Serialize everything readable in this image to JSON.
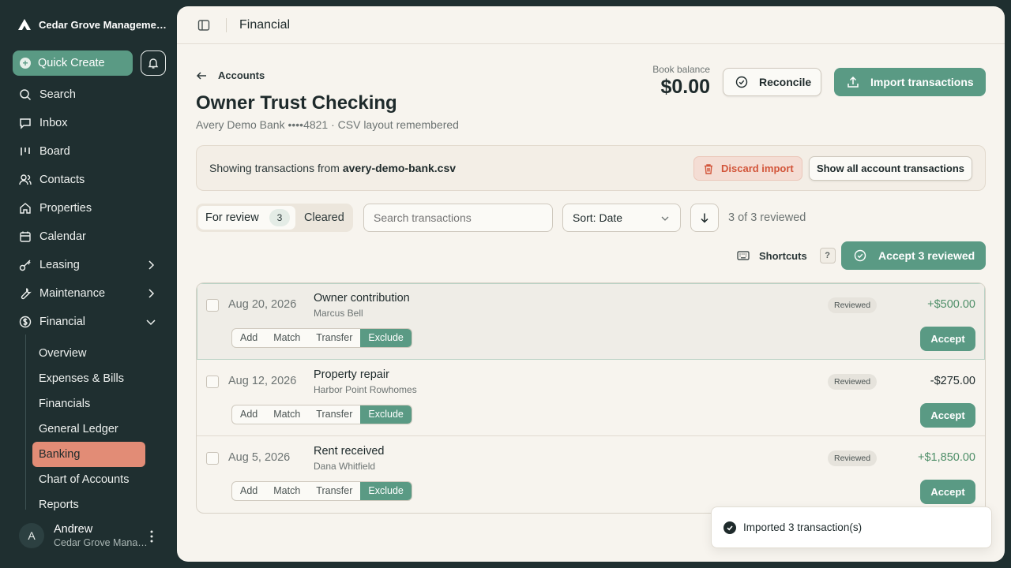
{
  "app": {
    "org_name": "Cedar Grove Manageme…"
  },
  "sidebar": {
    "quick_create": "Quick Create",
    "items": [
      {
        "label": "Search",
        "icon": "search-icon"
      },
      {
        "label": "Inbox",
        "icon": "inbox-icon"
      },
      {
        "label": "Board",
        "icon": "board-icon"
      },
      {
        "label": "Contacts",
        "icon": "contacts-icon"
      },
      {
        "label": "Properties",
        "icon": "home-icon"
      },
      {
        "label": "Calendar",
        "icon": "calendar-icon"
      },
      {
        "label": "Leasing",
        "icon": "key-icon"
      },
      {
        "label": "Maintenance",
        "icon": "wrench-icon"
      },
      {
        "label": "Financial",
        "icon": "dollar-icon"
      }
    ],
    "financial_sub": [
      "Overview",
      "Expenses & Bills",
      "Financials",
      "General Ledger",
      "Banking",
      "Chart of Accounts",
      "Reports"
    ],
    "active_sub": "Banking",
    "user": {
      "initial": "A",
      "name": "Andrew",
      "org": "Cedar Grove Mana…"
    }
  },
  "header": {
    "title": "Financial"
  },
  "account": {
    "back_label": "Accounts",
    "name": "Owner Trust Checking",
    "subtitle": "Avery Demo Bank ••••4821 · CSV layout remembered",
    "balance_label": "Book balance",
    "balance_value": "$0.00",
    "reconcile_label": "Reconcile",
    "import_label": "Import transactions"
  },
  "banner": {
    "prefix": "Showing transactions from ",
    "file": "avery-demo-bank.csv",
    "discard_label": "Discard import",
    "show_all_label": "Show all account transactions"
  },
  "filters": {
    "tab_review": "For review",
    "tab_review_count": "3",
    "tab_cleared": "Cleared",
    "search_placeholder": "Search transactions",
    "sort_label": "Sort: Date",
    "reviewed_status": "3 of 3 reviewed",
    "shortcuts_label": "Shortcuts",
    "shortcuts_key": "?",
    "accept_all_label": "Accept 3 reviewed"
  },
  "transactions": [
    {
      "date": "Aug 20, 2026",
      "description": "Owner contribution",
      "payee": "Marcus Bell",
      "status": "Reviewed",
      "amount": "+$500.00",
      "direction": "in"
    },
    {
      "date": "Aug 12, 2026",
      "description": "Property repair",
      "payee": "Harbor Point Rowhomes",
      "status": "Reviewed",
      "amount": "-$275.00",
      "direction": "out"
    },
    {
      "date": "Aug 5, 2026",
      "description": "Rent received",
      "payee": "Dana Whitfield",
      "status": "Reviewed",
      "amount": "+$1,850.00",
      "direction": "in"
    }
  ],
  "row_actions": {
    "add": "Add",
    "match": "Match",
    "transfer": "Transfer",
    "exclude": "Exclude",
    "accept": "Accept"
  },
  "toast": {
    "message": "Imported 3 transaction(s)"
  },
  "colors": {
    "accent": "#5a9a84",
    "active_nav": "#e28c76",
    "sidebar_bg": "#1f2f30",
    "danger": "#d2553a",
    "positive": "#4f8f69"
  }
}
